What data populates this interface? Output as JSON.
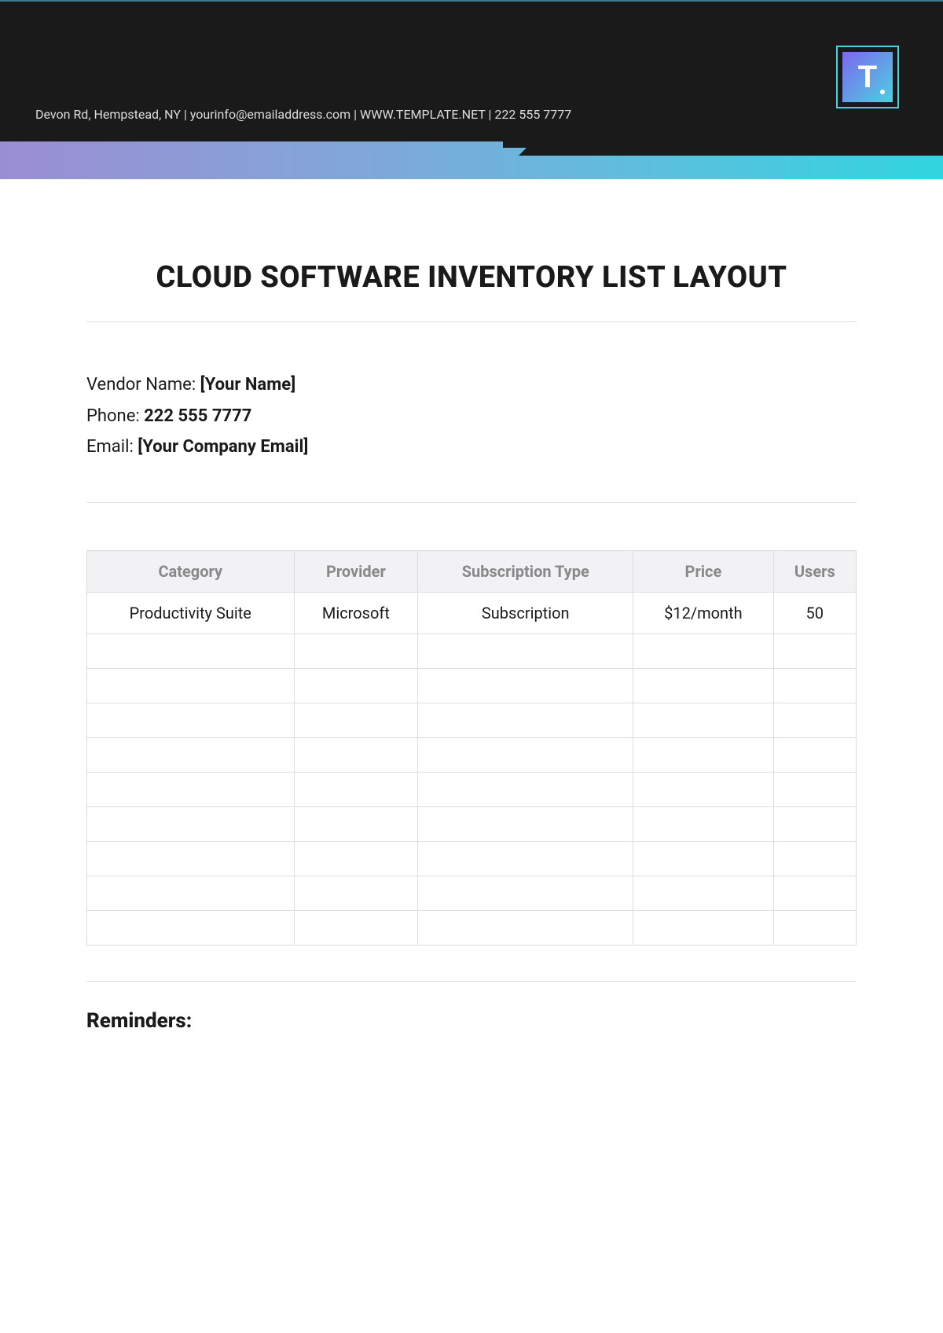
{
  "header": {
    "info_line": "Devon Rd, Hempstead, NY | yourinfo@emailaddress.com | WWW.TEMPLATE.NET | 222 555 7777",
    "logo_letter": "T"
  },
  "title": "CLOUD SOFTWARE INVENTORY LIST LAYOUT",
  "vendor": {
    "name_label": "Vendor Name: ",
    "name_value": "[Your Name]",
    "phone_label": "Phone: ",
    "phone_value": "222 555 7777",
    "email_label": "Email: ",
    "email_value": "[Your Company Email]"
  },
  "table": {
    "headers": {
      "category": "Category",
      "provider": "Provider",
      "subscription_type": "Subscription Type",
      "price": "Price",
      "users": "Users"
    },
    "rows": [
      {
        "category": "Productivity Suite",
        "provider": "Microsoft",
        "subscription_type": "Subscription",
        "price": "$12/month",
        "users": "50"
      },
      {
        "category": "",
        "provider": "",
        "subscription_type": "",
        "price": "",
        "users": ""
      },
      {
        "category": "",
        "provider": "",
        "subscription_type": "",
        "price": "",
        "users": ""
      },
      {
        "category": "",
        "provider": "",
        "subscription_type": "",
        "price": "",
        "users": ""
      },
      {
        "category": "",
        "provider": "",
        "subscription_type": "",
        "price": "",
        "users": ""
      },
      {
        "category": "",
        "provider": "",
        "subscription_type": "",
        "price": "",
        "users": ""
      },
      {
        "category": "",
        "provider": "",
        "subscription_type": "",
        "price": "",
        "users": ""
      },
      {
        "category": "",
        "provider": "",
        "subscription_type": "",
        "price": "",
        "users": ""
      },
      {
        "category": "",
        "provider": "",
        "subscription_type": "",
        "price": "",
        "users": ""
      },
      {
        "category": "",
        "provider": "",
        "subscription_type": "",
        "price": "",
        "users": ""
      }
    ]
  },
  "reminders": {
    "title": "Reminders:"
  }
}
